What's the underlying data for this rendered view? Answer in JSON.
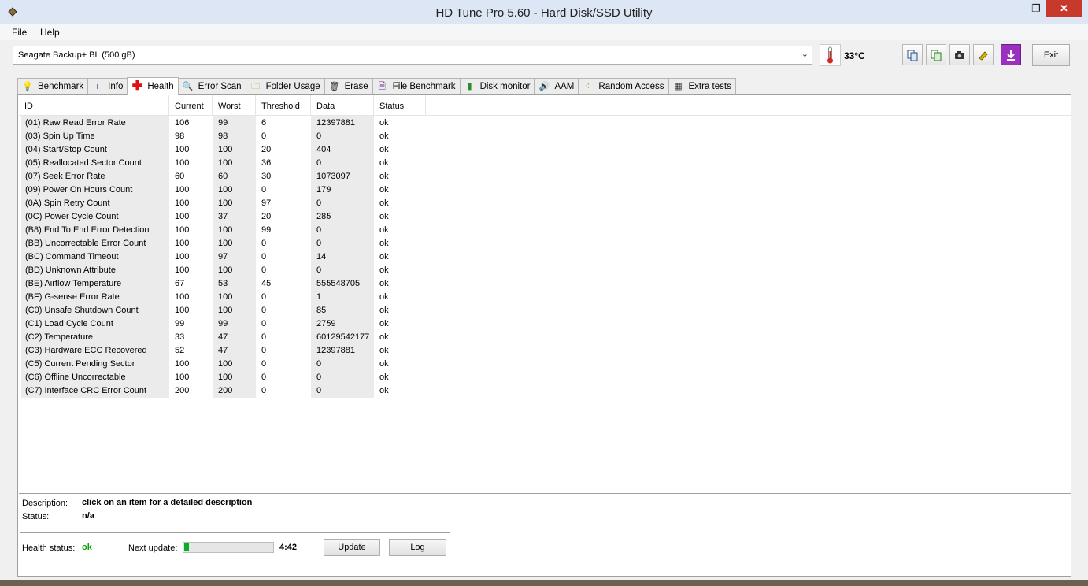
{
  "window": {
    "title": "HD Tune Pro 5.60 - Hard Disk/SSD Utility",
    "minimize": "–",
    "maximize": "❐",
    "close": "✕"
  },
  "menu": [
    {
      "label": "File"
    },
    {
      "label": "Help"
    }
  ],
  "drive": {
    "selected": "Seagate Backup+ BL (500 gB)",
    "temperature": "33°C"
  },
  "toolbar": {
    "exit_label": "Exit"
  },
  "tabs": [
    {
      "label": "Benchmark"
    },
    {
      "label": "Info"
    },
    {
      "label": "Health"
    },
    {
      "label": "Error Scan"
    },
    {
      "label": "Folder Usage"
    },
    {
      "label": "Erase"
    },
    {
      "label": "File Benchmark"
    },
    {
      "label": "Disk monitor"
    },
    {
      "label": "AAM"
    },
    {
      "label": "Random Access"
    },
    {
      "label": "Extra tests"
    }
  ],
  "health": {
    "columns": [
      "ID",
      "Current",
      "Worst",
      "Threshold",
      "Data",
      "Status"
    ],
    "rows": [
      [
        "(01) Raw Read Error Rate",
        "106",
        "99",
        "6",
        "12397881",
        "ok"
      ],
      [
        "(03) Spin Up Time",
        "98",
        "98",
        "0",
        "0",
        "ok"
      ],
      [
        "(04) Start/Stop Count",
        "100",
        "100",
        "20",
        "404",
        "ok"
      ],
      [
        "(05) Reallocated Sector Count",
        "100",
        "100",
        "36",
        "0",
        "ok"
      ],
      [
        "(07) Seek Error Rate",
        "60",
        "60",
        "30",
        "1073097",
        "ok"
      ],
      [
        "(09) Power On Hours Count",
        "100",
        "100",
        "0",
        "179",
        "ok"
      ],
      [
        "(0A) Spin Retry Count",
        "100",
        "100",
        "97",
        "0",
        "ok"
      ],
      [
        "(0C) Power Cycle Count",
        "100",
        "37",
        "20",
        "285",
        "ok"
      ],
      [
        "(B8) End To End Error Detection",
        "100",
        "100",
        "99",
        "0",
        "ok"
      ],
      [
        "(BB) Uncorrectable Error Count",
        "100",
        "100",
        "0",
        "0",
        "ok"
      ],
      [
        "(BC) Command Timeout",
        "100",
        "97",
        "0",
        "14",
        "ok"
      ],
      [
        "(BD) Unknown Attribute",
        "100",
        "100",
        "0",
        "0",
        "ok"
      ],
      [
        "(BE) Airflow Temperature",
        "67",
        "53",
        "45",
        "555548705",
        "ok"
      ],
      [
        "(BF) G-sense Error Rate",
        "100",
        "100",
        "0",
        "1",
        "ok"
      ],
      [
        "(C0) Unsafe Shutdown Count",
        "100",
        "100",
        "0",
        "85",
        "ok"
      ],
      [
        "(C1) Load Cycle Count",
        "99",
        "99",
        "0",
        "2759",
        "ok"
      ],
      [
        "(C2) Temperature",
        "33",
        "47",
        "0",
        "60129542177",
        "ok"
      ],
      [
        "(C3) Hardware ECC Recovered",
        "52",
        "47",
        "0",
        "12397881",
        "ok"
      ],
      [
        "(C5) Current Pending Sector",
        "100",
        "100",
        "0",
        "0",
        "ok"
      ],
      [
        "(C6) Offline Uncorrectable",
        "100",
        "100",
        "0",
        "0",
        "ok"
      ],
      [
        "(C7) Interface CRC Error Count",
        "200",
        "200",
        "0",
        "0",
        "ok"
      ]
    ]
  },
  "details": {
    "description_label": "Description:",
    "description_value": "click on an item for a detailed description",
    "status_label": "Status:",
    "status_value": "n/a"
  },
  "footer": {
    "health_status_label": "Health status:",
    "health_status_value": "ok",
    "next_update_label": "Next update:",
    "next_update_time": "4:42",
    "progress_fraction": 0.05,
    "update_button": "Update",
    "log_button": "Log"
  }
}
